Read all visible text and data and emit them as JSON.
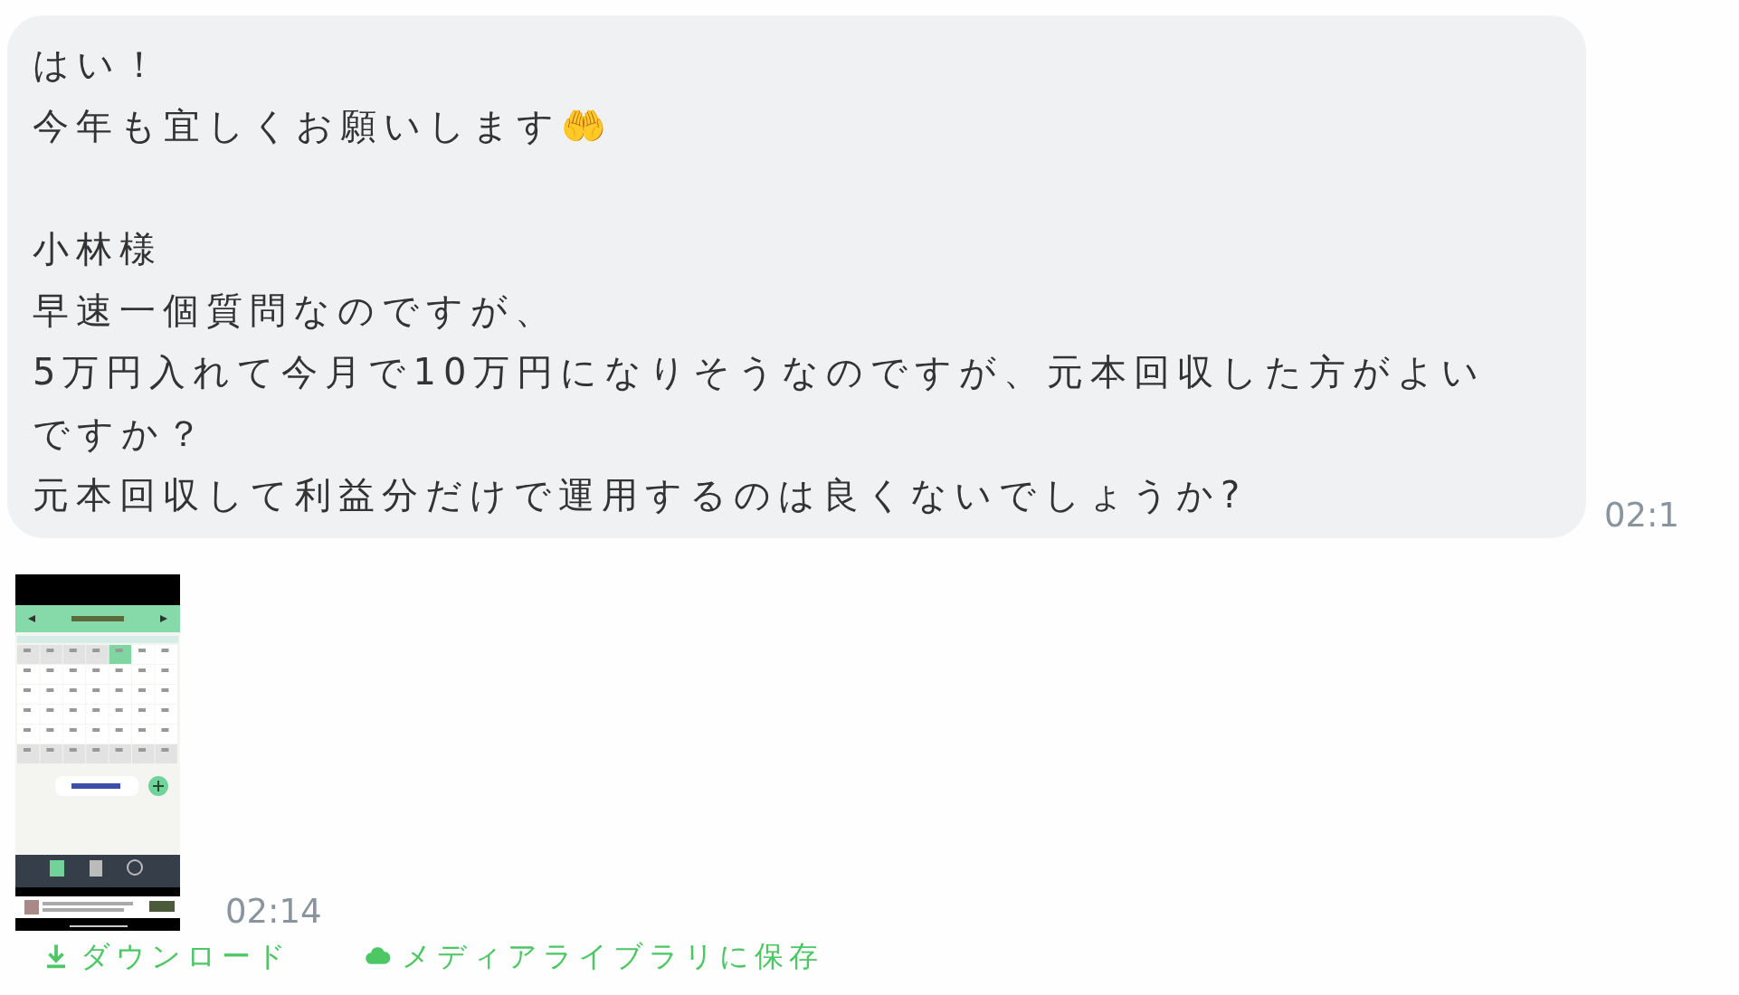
{
  "messages": [
    {
      "kind": "text",
      "paragraphs": [
        [
          "はい！",
          "今年も宜しくお願いします🤲"
        ],
        [
          "小林様",
          "早速一個質問なのですが、",
          "5万円入れて今月で10万円になりそうなのですが、元本回収した方がよい",
          "ですか？",
          "元本回収して利益分だけで運用するのは良くないでしょうか?"
        ]
      ],
      "time": "02:1"
    },
    {
      "kind": "image",
      "time": "02:14",
      "actions": [
        {
          "kind": "download",
          "label": "ダウンロード"
        },
        {
          "kind": "save",
          "label": "メディアライブラリに保存"
        }
      ]
    }
  ]
}
